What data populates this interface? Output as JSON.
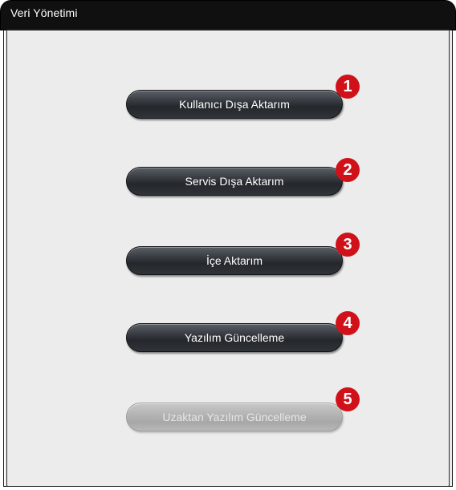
{
  "window": {
    "title": "Veri Yönetimi"
  },
  "buttons": [
    {
      "label": "Kullanıcı Dışa Aktarım",
      "enabled": true,
      "callout": "1"
    },
    {
      "label": "Servis Dışa Aktarım",
      "enabled": true,
      "callout": "2"
    },
    {
      "label": "İçe Aktarım",
      "enabled": true,
      "callout": "3"
    },
    {
      "label": "Yazılım Güncelleme",
      "enabled": true,
      "callout": "4"
    },
    {
      "label": "Uzaktan Yazılım Güncelleme",
      "enabled": false,
      "callout": "5"
    }
  ],
  "colors": {
    "titlebar": "#101010",
    "panel": "#ececec",
    "button_dark": "#2a2d31",
    "button_disabled": "#b4b4b4",
    "callout": "#d0111a"
  }
}
